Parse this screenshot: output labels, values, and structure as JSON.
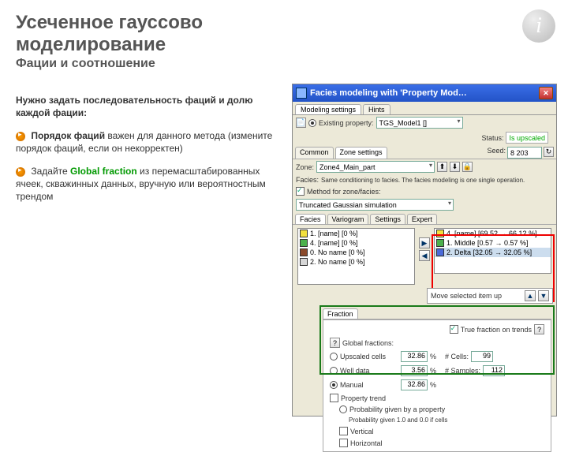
{
  "title_line1": "Усеченное гауссово",
  "title_line2": "моделирование",
  "subtitle": "Фации и соотношение",
  "intro": "Нужно задать последовательность фаций и долю каждой фации:",
  "b1_strong": "Порядок фаций",
  "b1_rest": " важен для данного метода (измените порядок фаций, если он некорректен)",
  "b2_pre": "Задайте ",
  "b2_term": "Global fraction",
  "b2_rest": " из перемасштабированных ячеек, скважинных данных, вручную или вероятностным трендом",
  "win": {
    "title": "Facies modeling with 'Property Mod…",
    "tabs": {
      "t1": "Modeling settings",
      "t2": "Hints"
    },
    "existing": "Existing property:",
    "existing_val": "TGS_Model1 []",
    "status": "Status:",
    "status_val": "Is upscaled",
    "subtabs": {
      "a": "Common",
      "b": "Zone settings"
    },
    "seed": "Seed:",
    "seed_val": "8 203",
    "zone": "Zone:",
    "zone_val": "Zone4_Main_part",
    "faciesrow": "Facies:",
    "faciesnote": "Same conditioning to facies. The facies modeling is one single operation.",
    "method": "Method for zone/facies:",
    "method_val": "Truncated Gaussian simulation",
    "innertabs": {
      "a": "Facies",
      "b": "Variogram",
      "c": "Settings",
      "d": "Expert"
    },
    "facies": [
      {
        "color": "#f2df3e",
        "name": "1. [name] [0 %]"
      },
      {
        "color": "#4cb04c",
        "name": "4. [name] [0 %]"
      },
      {
        "color": "#8b4a2b",
        "name": "0. No name [0 %]"
      },
      {
        "color": "#d7d7d7",
        "name": "2. No name [0 %]"
      }
    ],
    "order": [
      {
        "color": "#f2df3e",
        "name": "4. [name] [69.52 → 66.12 %]"
      },
      {
        "color": "#4cb04c",
        "name": "1. Middle [0.57 → 0.57 %]"
      },
      {
        "color": "#4a6ad9",
        "name": "2. Delta [32.05 → 32.05 %]"
      }
    ],
    "move": "Move selected item up",
    "fraction": {
      "tab": "Fraction",
      "trueonterands": "True fraction on trends",
      "global": "Global fractions:",
      "rows": [
        {
          "r": "Upscaled cells",
          "v": "32.86",
          "c": "# Cells:",
          "cv": "99"
        },
        {
          "r": "Well data",
          "v": "3.56",
          "c": "# Samples:",
          "cv": "112"
        },
        {
          "r": "Manual",
          "v": "32.86"
        }
      ],
      "proptrend": "Property trend",
      "probgiven": "Probability given by a property",
      "probnote": "Probability given 1.0 and 0.0 if cells",
      "vertical": "Vertical",
      "horizontal": "Horizontal"
    }
  }
}
